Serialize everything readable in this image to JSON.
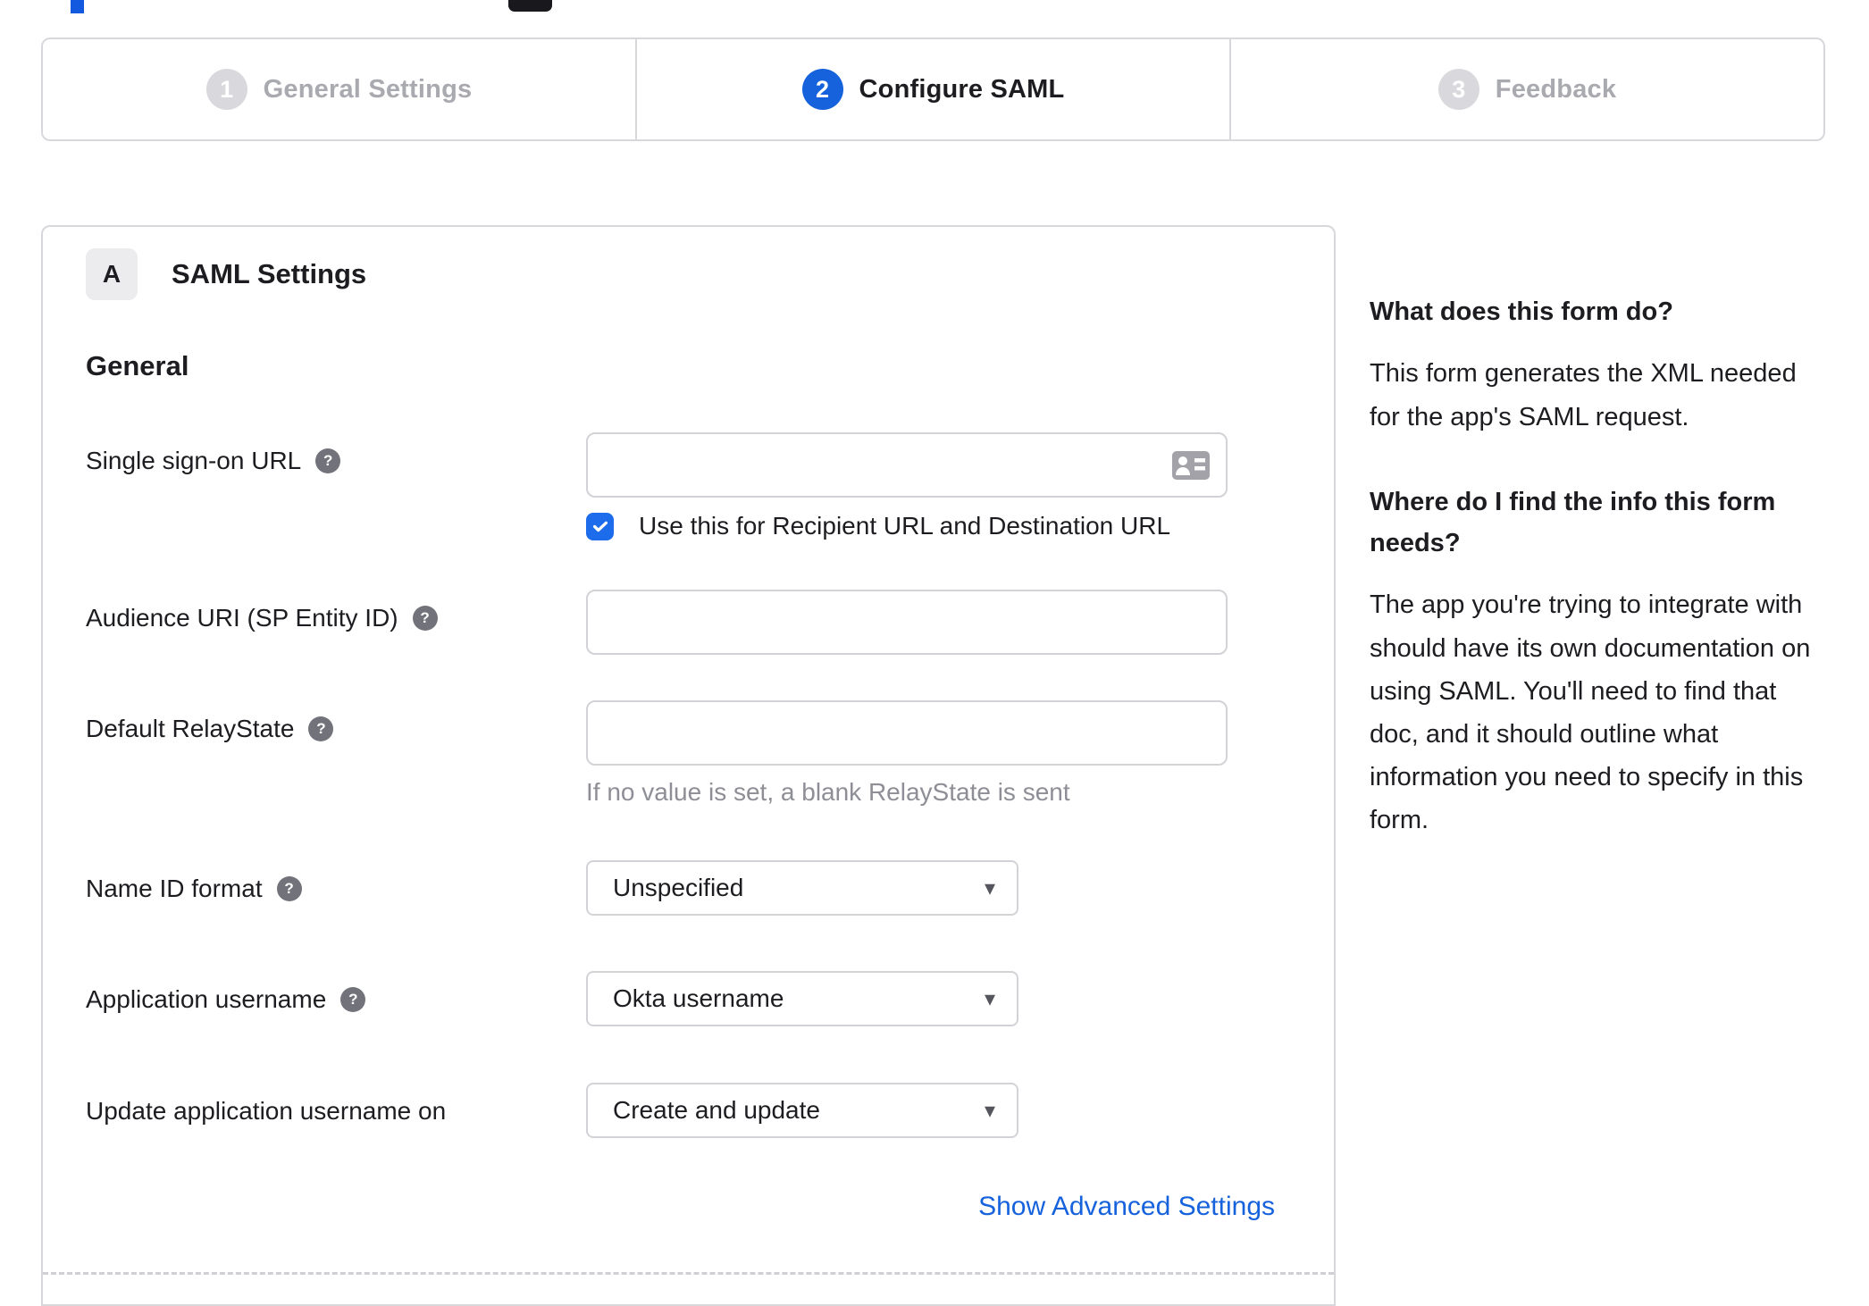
{
  "stepper": {
    "steps": [
      {
        "number": "1",
        "label": "General Settings",
        "state": "inactive"
      },
      {
        "number": "2",
        "label": "Configure SAML",
        "state": "active"
      },
      {
        "number": "3",
        "label": "Feedback",
        "state": "inactive"
      }
    ]
  },
  "panel": {
    "badge": "A",
    "title": "SAML Settings",
    "section_title": "General"
  },
  "form": {
    "sso": {
      "label": "Single sign-on URL",
      "value": "",
      "checkbox_label": "Use this for Recipient URL and Destination URL",
      "checkbox_checked": true
    },
    "audience": {
      "label": "Audience URI (SP Entity ID)",
      "value": ""
    },
    "relay": {
      "label": "Default RelayState",
      "value": "",
      "help": "If no value is set, a blank RelayState is sent"
    },
    "name_id": {
      "label": "Name ID format",
      "value": "Unspecified"
    },
    "app_username": {
      "label": "Application username",
      "value": "Okta username"
    },
    "update_username": {
      "label": "Update application username on",
      "value": "Create and update"
    },
    "advanced_link": "Show Advanced Settings"
  },
  "sidebar": {
    "sections": [
      {
        "heading": "What does this form do?",
        "body": "This form generates the XML needed for the app's SAML request."
      },
      {
        "heading": "Where do I find the info this form needs?",
        "body": "The app you're trying to integrate with should have its own documentation on using SAML. You'll need to find that doc, and it should outline what information you need to specify in this form."
      }
    ]
  },
  "icons": {
    "help_glyph": "?",
    "caret_glyph": "▾"
  },
  "colors": {
    "accent_blue": "#1662dd",
    "checkbox_blue": "#1c6ceb",
    "link_blue": "#1662dd",
    "inactive_step_gray": "#d9d9dd",
    "text_dark": "#1d1d21",
    "muted_gray": "#a9a9b0",
    "helper_gray": "#8e8e96",
    "border_gray": "#d8d8dc"
  }
}
